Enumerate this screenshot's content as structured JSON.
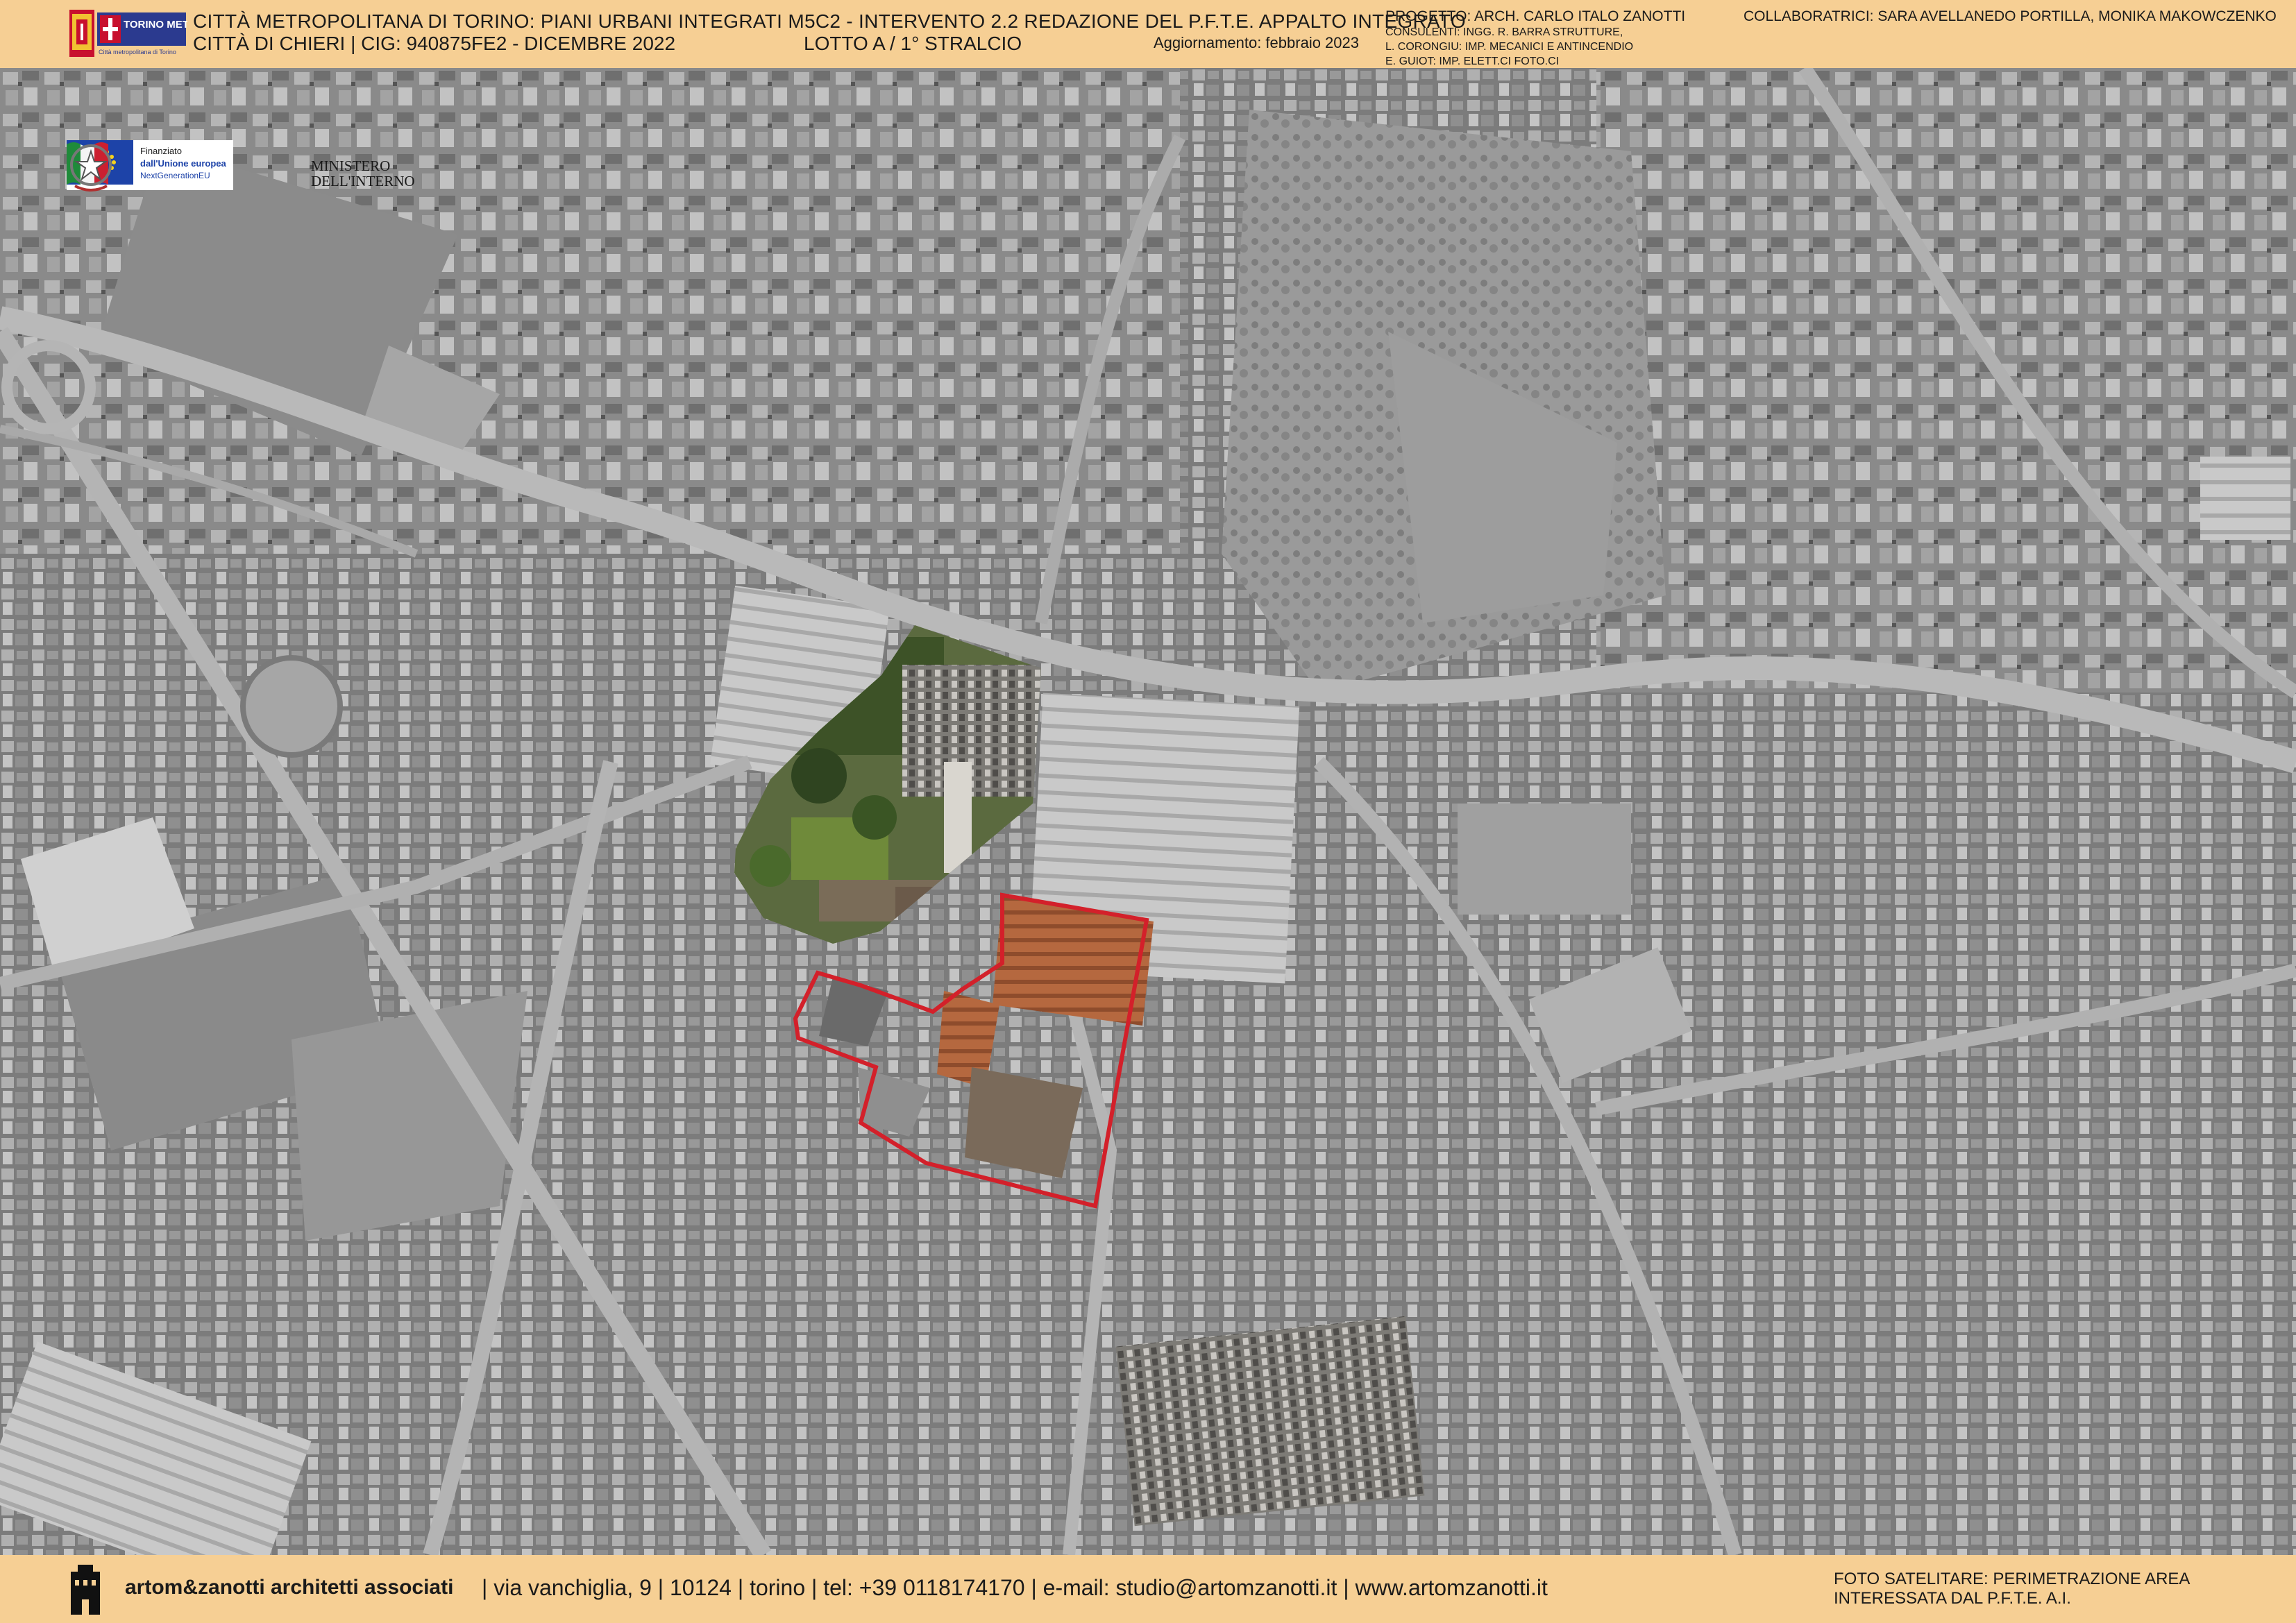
{
  "header": {
    "title_main": "CITTÀ METROPOLITANA DI TORINO: PIANI URBANI INTEGRATI M5C2 - INTERVENTO 2.2 REDAZIONE DEL P.F.T.E. APPALTO INTEGRATO",
    "title_sub": "CITTÀ DI CHIERI  |  CIG: 940875FE2 - DICEMBRE 2022",
    "lotto": "LOTTO A / 1° STRALCIO",
    "update": "Aggiornamento: febbraio 2023",
    "emblem_text": "TORINO METROPOLI",
    "emblem_subtext": "Città metropolitana di Torino",
    "credits": {
      "project": "PROGETTO: ARCH. CARLO ITALO ZANOTTI",
      "consultants_1": "CONSULENTI: INGG. R. BARRA STRUTTURE,",
      "consultants_2": "L. CORONGIU: IMP. MECANICI E ANTINCENDIO",
      "consultants_3": "E. GUIOT: IMP. ELETT.CI FOTO.CI"
    },
    "collaborators": "COLLABORATRICI: SARA AVELLANEDO PORTILLA, MONIKA MAKOWCZENKO"
  },
  "logos": {
    "eu_line1": "Finanziato",
    "eu_line2": "dall'Unione europea",
    "eu_line3": "NextGenerationEU",
    "ministry_line1": "MINISTERO",
    "ministry_line2": "DELL'INTERNO",
    "eu_flag_color": "#1d43a8",
    "star_color": "#f4d21e"
  },
  "map": {
    "type": "satellite photo (grayscale) with colour highlight of the intervention area",
    "boundary_color": "#d3202a",
    "icons": [
      "eu-flag-icon",
      "italy-flag-icon",
      "republic-emblem-icon",
      "firm-logo-icon"
    ]
  },
  "footer": {
    "firm_name": "artom&zanotti architetti associati",
    "contacts": "| via vanchiglia, 9 | 10124 | torino | tel: +39 0118174170 | e-mail: studio@artomzanotti.it | www.artomzanotti.it",
    "caption_1": "FOTO SATELITARE: PERIMETRAZIONE AREA",
    "caption_2": "INTERESSATA DAL P.F.T.E.  A.I."
  }
}
